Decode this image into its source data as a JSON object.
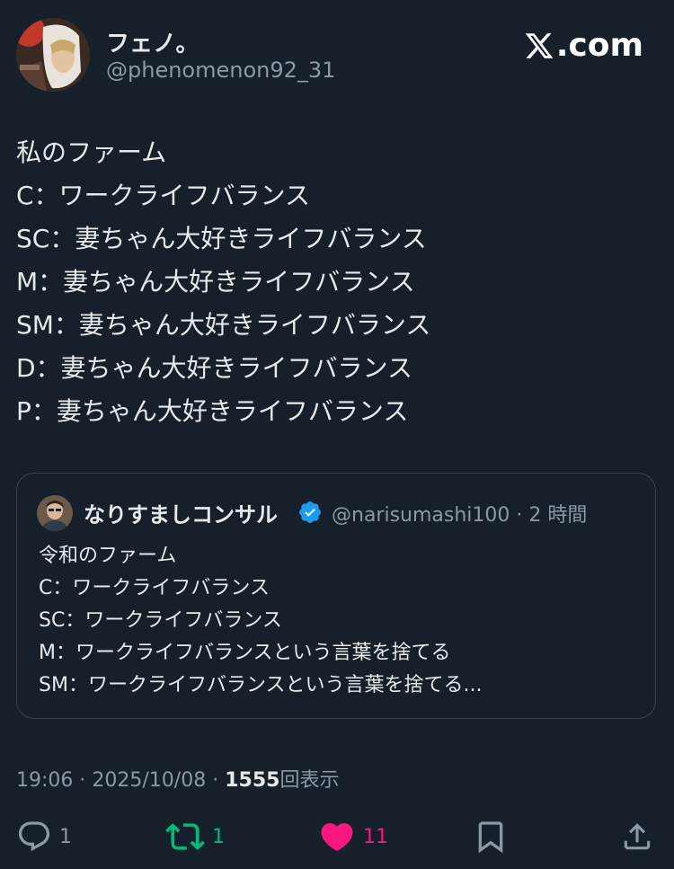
{
  "author": {
    "name": "フェノ。",
    "handle": "@phenomenon92_31"
  },
  "brand": {
    "text": ".com",
    "icon": "x-logo-icon"
  },
  "tweet": {
    "lines": [
      "私のファーム",
      "C：ワークライフバランス",
      "SC：妻ちゃん大好きライフバランス",
      "M：妻ちゃん大好きライフバランス",
      "SM：妻ちゃん大好きライフバランス",
      "D：妻ちゃん大好きライフバランス",
      "P：妻ちゃん大好きライフバランス"
    ]
  },
  "quote": {
    "name": "なりすましコンサル",
    "verified_icon": "verified-badge-icon",
    "handle": "@narisumashi100",
    "separator": "·",
    "time": "2 時間",
    "lines": [
      "令和のファーム",
      "C：ワークライフバランス",
      "SC：ワークライフバランス",
      "M：ワークライフバランスという言葉を捨てる",
      "SM：ワークライフバランスという言葉を捨てる..."
    ]
  },
  "meta": {
    "time": "19:06",
    "sep1": "·",
    "date": "2025/10/08",
    "sep2": "·",
    "views_count": "1555",
    "views_label": "回表示"
  },
  "actions": {
    "replies": "1",
    "retweets": "1",
    "likes": "11"
  },
  "colors": {
    "background": "#15202b",
    "text": "#e7e9ea",
    "secondary": "#8b98a5",
    "retweet": "#00ba7c",
    "like": "#f91880",
    "verified": "#1d9bf0",
    "border": "#38444d"
  }
}
